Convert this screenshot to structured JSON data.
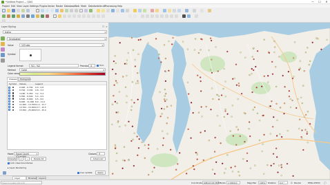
{
  "window": {
    "title": "*Untitled Project — QGIS",
    "controls": [
      "—",
      "☐",
      "✕"
    ]
  },
  "menu": [
    "Project",
    "Edit",
    "View",
    "Layer",
    "Settings",
    "Plugins",
    "Vector",
    "Raster",
    "Database",
    "Web",
    "Mesh",
    "Datafordeler.dk",
    "Processing",
    "Help"
  ],
  "dock": {
    "title": "Layer Styling",
    "layer": "trafco",
    "renderer": "Graduated",
    "value_label": "Value",
    "value": "123 abc",
    "symbol_label": "Symbol",
    "legend_format_label": "Legend format",
    "legend_format": "%1 - %2",
    "precision_label": "Precision",
    "precision": "4",
    "trim_label": "Trim",
    "method_label": "Method",
    "method": "Color",
    "ramp_label": "Color ramp",
    "tabs": [
      "Classes",
      "Histogram"
    ],
    "table_headers": [
      "Symbol",
      "Values",
      "Legend"
    ],
    "classes": [
      {
        "values": "0.000 - 0.794",
        "legend": "0.0 - 0.8",
        "color": "#f7fcb9"
      },
      {
        "values": "0.794 - 3.182",
        "legend": "0.8 - 3.2",
        "color": "#d9ef8b"
      },
      {
        "values": "3.182 - 5.350",
        "legend": "3.2 - 5.4",
        "color": "#fee08b"
      },
      {
        "values": "5.350 - 6.500",
        "legend": "5.4 - 6.5",
        "color": "#fdae61"
      },
      {
        "values": "6.500 - 8.000",
        "legend": "6.5 - 8.0",
        "color": "#f46d43"
      },
      {
        "values": "8.000 - 11.000",
        "legend": "8.0 - 11.0",
        "color": "#e34a33"
      },
      {
        "values": "11.000 - 13.700",
        "legend": "11.0 - 13.7",
        "color": "#d73027"
      },
      {
        "values": "13.700 - 15.500",
        "legend": "13.7 - 15.5",
        "color": "#b2182b"
      },
      {
        "values": "15.500 - 25.000",
        "legend": "15.5 - 25.0",
        "color": "#a50026"
      }
    ],
    "mode_label": "Mode",
    "mode": "Equal Count (Quantile)",
    "classes_label": "Classes",
    "classes_count": "9",
    "classify_label": "Classify",
    "add_label": "+",
    "remove_label": "−",
    "delete_all_label": "Delete All",
    "advanced_label": "Advanced",
    "link_class_label": "Link class boundaries",
    "layer_rendering_label": "Layer Rendering",
    "live_update_label": "Live update",
    "apply_label": "Apply",
    "bottom_tabs": [
      "Layer Styling",
      "Browser",
      "Layers"
    ]
  },
  "map": {
    "water_color": "#a8cde3",
    "land_color": "#f2efe9",
    "forest_color": "#cfe6c0",
    "road_color": "#f6c88c"
  },
  "statusbar": {
    "search_placeholder": "Type to locate (Ctrl+K)",
    "coordinate_label": "Coordinate",
    "coordinate": "698143,6178593",
    "scale_label": "Scale",
    "scale": "1:200211",
    "magnifier_label": "Magnifier",
    "magnifier": "100%",
    "rotation_label": "Rotation",
    "rotation": "0.0 °",
    "render_label": "Render",
    "crs": "EPSG:25832"
  }
}
